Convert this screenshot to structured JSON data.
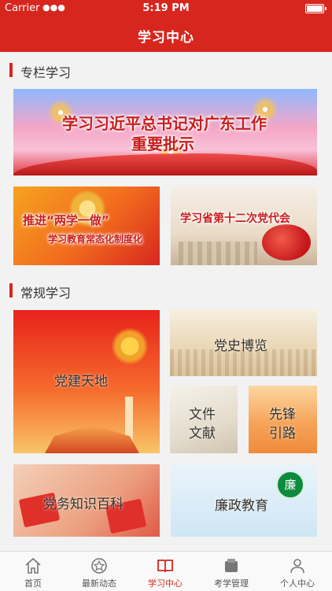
{
  "status_bar": {
    "carrier": "Carrier",
    "time": "5:19 PM"
  },
  "navbar": {
    "title": "学习中心"
  },
  "sections": {
    "special": {
      "label": "专栏学习"
    },
    "regular": {
      "label": "常规学习"
    }
  },
  "special_cards": {
    "banner": {
      "line1": "学习习近平总书记对广东工作",
      "line2": "重要批示"
    },
    "liangxue": {
      "line1": "推进“两学一做”",
      "line2": "学习教育常态化制度化"
    },
    "congress": {
      "line1": "学习省第十二次党代会"
    }
  },
  "regular_cards": {
    "dangjian": "党建天地",
    "dangshi": "党史博览",
    "wenjian_1": "文件",
    "wenjian_2": "文献",
    "xianfeng_1": "先锋",
    "xianfeng_2": "引路",
    "zhishi": "党务知识百科",
    "lianzheng": "廉政教育",
    "lianzheng_seal": "廉"
  },
  "tabbar": [
    {
      "label": "首页",
      "icon": "home-icon",
      "active": false
    },
    {
      "label": "最新动态",
      "icon": "news-icon",
      "active": false
    },
    {
      "label": "学习中心",
      "icon": "book-icon",
      "active": true
    },
    {
      "label": "考学管理",
      "icon": "exam-icon",
      "active": false
    },
    {
      "label": "个人中心",
      "icon": "person-icon",
      "active": false
    }
  ],
  "colors": {
    "accent": "#d7261e",
    "tab_inactive": "#555555"
  }
}
